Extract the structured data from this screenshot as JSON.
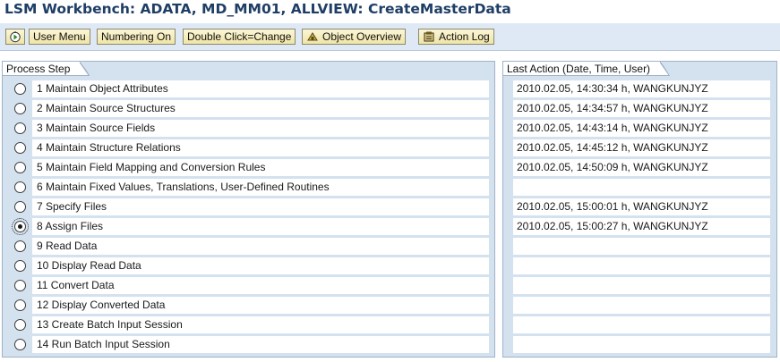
{
  "window": {
    "title": "LSM Workbench: ADATA, MD_MM01, ALLVIEW: CreateMasterData"
  },
  "toolbar": {
    "buttons": [
      {
        "label": "",
        "icon": "execute-icon"
      },
      {
        "label": "User Menu"
      },
      {
        "label": "Numbering On"
      },
      {
        "label": "Double Click=Change"
      },
      {
        "label": "Object Overview",
        "icon": "object-overview-icon"
      },
      {
        "label": "Action Log",
        "icon": "action-log-icon"
      }
    ]
  },
  "process_panel": {
    "header": "Process Step",
    "selected_index": 7,
    "steps": [
      {
        "label": "1 Maintain Object Attributes"
      },
      {
        "label": "2 Maintain Source Structures"
      },
      {
        "label": "3 Maintain Source Fields"
      },
      {
        "label": "4 Maintain Structure Relations"
      },
      {
        "label": "5 Maintain Field Mapping and Conversion Rules"
      },
      {
        "label": "6 Maintain Fixed Values, Translations, User-Defined Routines"
      },
      {
        "label": "7 Specify Files"
      },
      {
        "label": "8 Assign Files"
      },
      {
        "label": "9 Read Data"
      },
      {
        "label": "10 Display Read Data"
      },
      {
        "label": "11 Convert Data"
      },
      {
        "label": "12 Display Converted Data"
      },
      {
        "label": "13 Create Batch Input Session"
      },
      {
        "label": "14 Run Batch Input Session"
      }
    ]
  },
  "action_panel": {
    "header": "Last Action (Date, Time, User)",
    "entries": [
      "2010.02.05, 14:30:34 h, WANGKUNJYZ",
      "2010.02.05, 14:34:57 h, WANGKUNJYZ",
      "2010.02.05, 14:43:14 h, WANGKUNJYZ",
      "2010.02.05, 14:45:12 h, WANGKUNJYZ",
      "2010.02.05, 14:50:09 h, WANGKUNJYZ",
      "",
      "2010.02.05, 15:00:01 h, WANGKUNJYZ",
      "2010.02.05, 15:00:27 h, WANGKUNJYZ",
      "",
      "",
      "",
      "",
      "",
      ""
    ]
  },
  "colors": {
    "title": "#1f3e66",
    "toolbar_bg": "#dfe9f5",
    "panel_bg": "#d4e1ef",
    "button_bg": "#efe4a8"
  }
}
